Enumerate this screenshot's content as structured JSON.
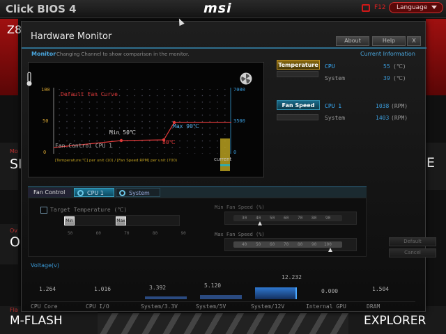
{
  "app_title": "Click BIOS 4",
  "brand": "msi",
  "topbar": {
    "f12_label": "F12",
    "language_label": "Language"
  },
  "background_tiles": {
    "left_top_label": "Z8",
    "left_mid1_small": "Mo",
    "left_mid1_label": "SI",
    "left_mid2_small": "Ov",
    "left_mid2_label": "O",
    "left_bottom_small": "Fla",
    "left_bottom_label": "M-FLASH",
    "right_mid1_label": "E",
    "right_bottom_label": "EXPLORER"
  },
  "dialog": {
    "title": "Hardware Monitor",
    "buttons": {
      "about": "About",
      "help": "Help",
      "close": "X"
    }
  },
  "monitor": {
    "label": "Monitor",
    "hint": "Changing Channel to show comparison in the monitor.",
    "current_info_label": "Current  Information"
  },
  "graph": {
    "curve_label": "Default Fan Curve",
    "max_point_label": "Max 90℃",
    "min_point_label": "Min 50℃",
    "mid_point_label": "80℃",
    "channel_label": "Fan Control  CPU 1",
    "current_label": "current",
    "legend_text": "[Temperature:℃] per unit (10)   /   [Fan Speed:RPM] per unit (700)",
    "left_ticks": [
      "100",
      "50",
      "0"
    ],
    "right_ticks": [
      "7000",
      "3500",
      "0"
    ],
    "curve_color": "#e03a3a",
    "current_bar_color": "#b8a020"
  },
  "current_information": {
    "temperature_tag": "Temperature",
    "fan_speed_tag": "Fan Speed",
    "temperatures": [
      {
        "name": "CPU",
        "value": "55",
        "unit": "(℃)"
      },
      {
        "name": "System",
        "value": "39",
        "unit": "(℃)"
      }
    ],
    "fans": [
      {
        "name": "CPU 1",
        "value": "1038",
        "unit": "(RPM)"
      },
      {
        "name": "System",
        "value": "1403",
        "unit": "(RPM)"
      }
    ]
  },
  "fan_control": {
    "tabs": {
      "fan_control": "Fan Control",
      "cpu1": "CPU 1",
      "system": "System"
    },
    "target_temperature_label": "Target Temperature (℃)",
    "target_min_label": "Min",
    "target_max_label": "Max",
    "target_ticks": [
      "50",
      "60",
      "70",
      "80",
      "90"
    ],
    "min_fan_speed_label": "Min Fan Speed (%)",
    "min_fan_ticks": [
      "30",
      "40",
      "50",
      "60",
      "70",
      "80",
      "90"
    ],
    "min_fan_value": 40,
    "max_fan_speed_label": "Max Fan Speed (%)",
    "max_fan_ticks": [
      "40",
      "50",
      "60",
      "70",
      "80",
      "90",
      "100"
    ],
    "max_fan_value": 100,
    "default_button": "Default",
    "cancel_button": "Cancel"
  },
  "voltage": {
    "label": "Voltage(v)",
    "items": [
      {
        "name": "CPU Core",
        "value": "1.264"
      },
      {
        "name": "CPU I/O",
        "value": "1.016"
      },
      {
        "name": "System/3.3V",
        "value": "3.392"
      },
      {
        "name": "System/5V",
        "value": "5.120"
      },
      {
        "name": "System/12V",
        "value": "12.232"
      },
      {
        "name": "Internal GPU",
        "value": "0.000"
      },
      {
        "name": "DRAM",
        "value": "1.504"
      }
    ]
  }
}
